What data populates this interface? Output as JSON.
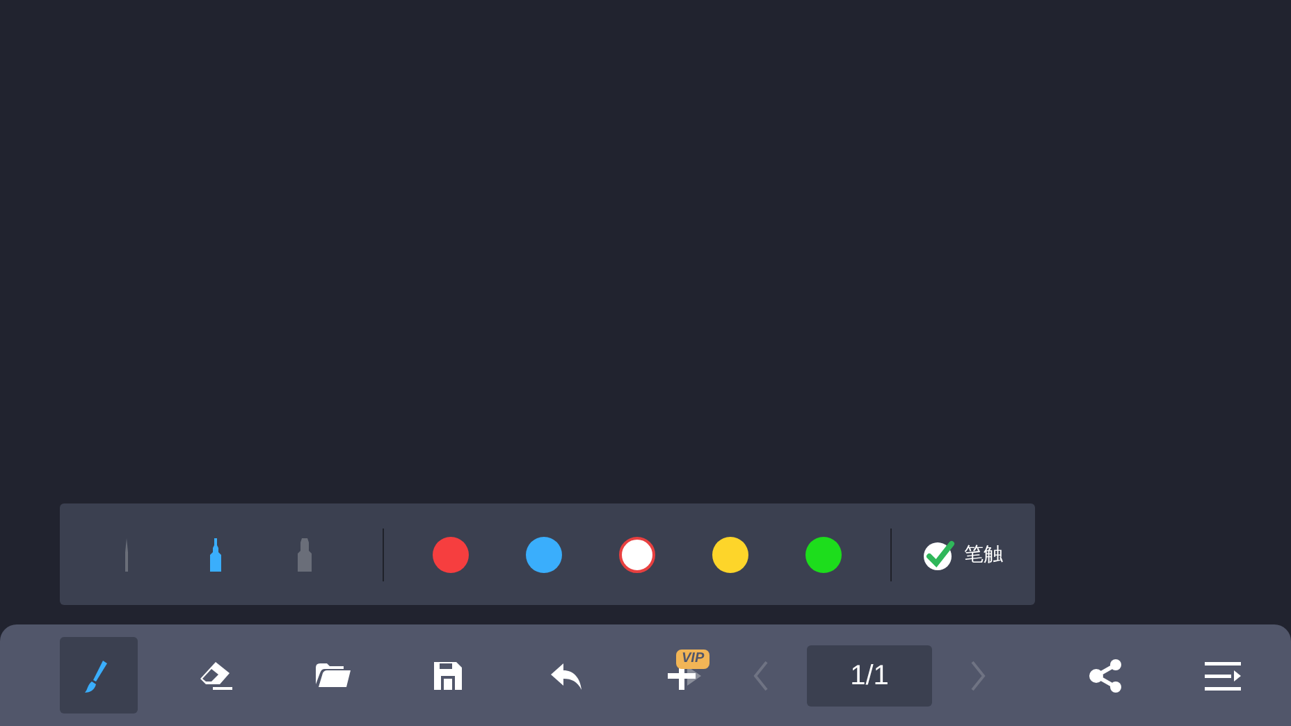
{
  "palette": {
    "pens": [
      {
        "kind": "fine",
        "selected": false
      },
      {
        "kind": "medium",
        "selected": true
      },
      {
        "kind": "thick",
        "selected": false
      }
    ],
    "colors": [
      {
        "color": "#f63e3f",
        "selected": false
      },
      {
        "color": "#3aaefc",
        "selected": false
      },
      {
        "color": "#ffffff",
        "selected": true
      },
      {
        "color": "#fdd52a",
        "selected": false
      },
      {
        "color": "#1ddd1c",
        "selected": false
      }
    ],
    "pen_touch": {
      "label": "笔触",
      "checked": true
    }
  },
  "toolbar": {
    "tools": [
      {
        "kind": "brush",
        "selected": true
      },
      {
        "kind": "eraser",
        "selected": false
      },
      {
        "kind": "folder",
        "selected": false
      },
      {
        "kind": "save",
        "selected": false
      },
      {
        "kind": "undo",
        "selected": false
      },
      {
        "kind": "add-page",
        "selected": false,
        "badge": "VIP"
      }
    ],
    "prev": {
      "disabled": true
    },
    "page": "1/1",
    "next": {
      "disabled": true
    },
    "actions": [
      {
        "kind": "share"
      },
      {
        "kind": "menu"
      }
    ]
  }
}
